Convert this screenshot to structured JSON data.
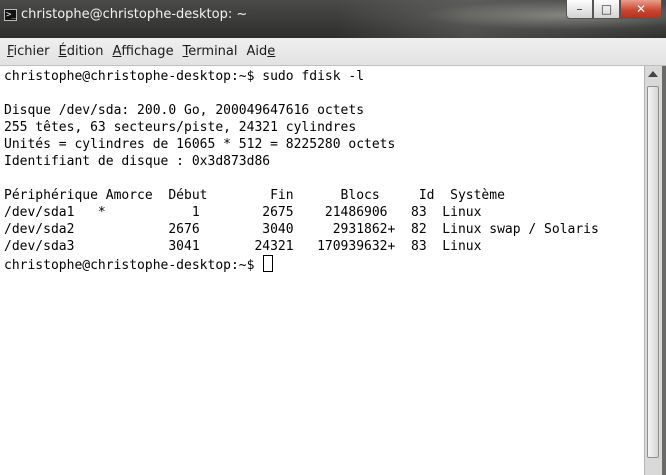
{
  "window": {
    "title": "christophe@christophe-desktop: ~",
    "icon": "terminal-icon",
    "icon_glyph": ">_",
    "buttons": {
      "minimize_glyph": "–",
      "maximize_glyph": "□",
      "close_glyph": "✕"
    }
  },
  "menubar": {
    "items": [
      {
        "mnemonic": "F",
        "rest": "ichier"
      },
      {
        "mnemonic": "É",
        "rest": "dition"
      },
      {
        "mnemonic": "A",
        "rest": "ffichage"
      },
      {
        "mnemonic": "T",
        "rest": "erminal"
      },
      {
        "pre": "Aid",
        "mnemonic": "e",
        "rest": ""
      }
    ]
  },
  "terminal": {
    "lines": [
      "christophe@christophe-desktop:~$ sudo fdisk -l",
      "",
      "Disque /dev/sda: 200.0 Go, 200049647616 octets",
      "255 têtes, 63 secteurs/piste, 24321 cylindres",
      "Unités = cylindres de 16065 * 512 = 8225280 octets",
      "Identifiant de disque : 0x3d873d86",
      "",
      "Périphérique Amorce  Début        Fin      Blocs     Id  Système",
      "/dev/sda1   *           1        2675    21486906   83  Linux",
      "/dev/sda2            2676        3040     2931862+  82  Linux swap / Solaris",
      "/dev/sda3            3041       24321   170939632+  83  Linux"
    ],
    "prompt": "christophe@christophe-desktop:~$ "
  },
  "colors": {
    "terminal_bg": "#ffffff",
    "terminal_fg": "#000000",
    "menubar_bg": "#e8e8e8",
    "close_button": "#c9432c"
  }
}
